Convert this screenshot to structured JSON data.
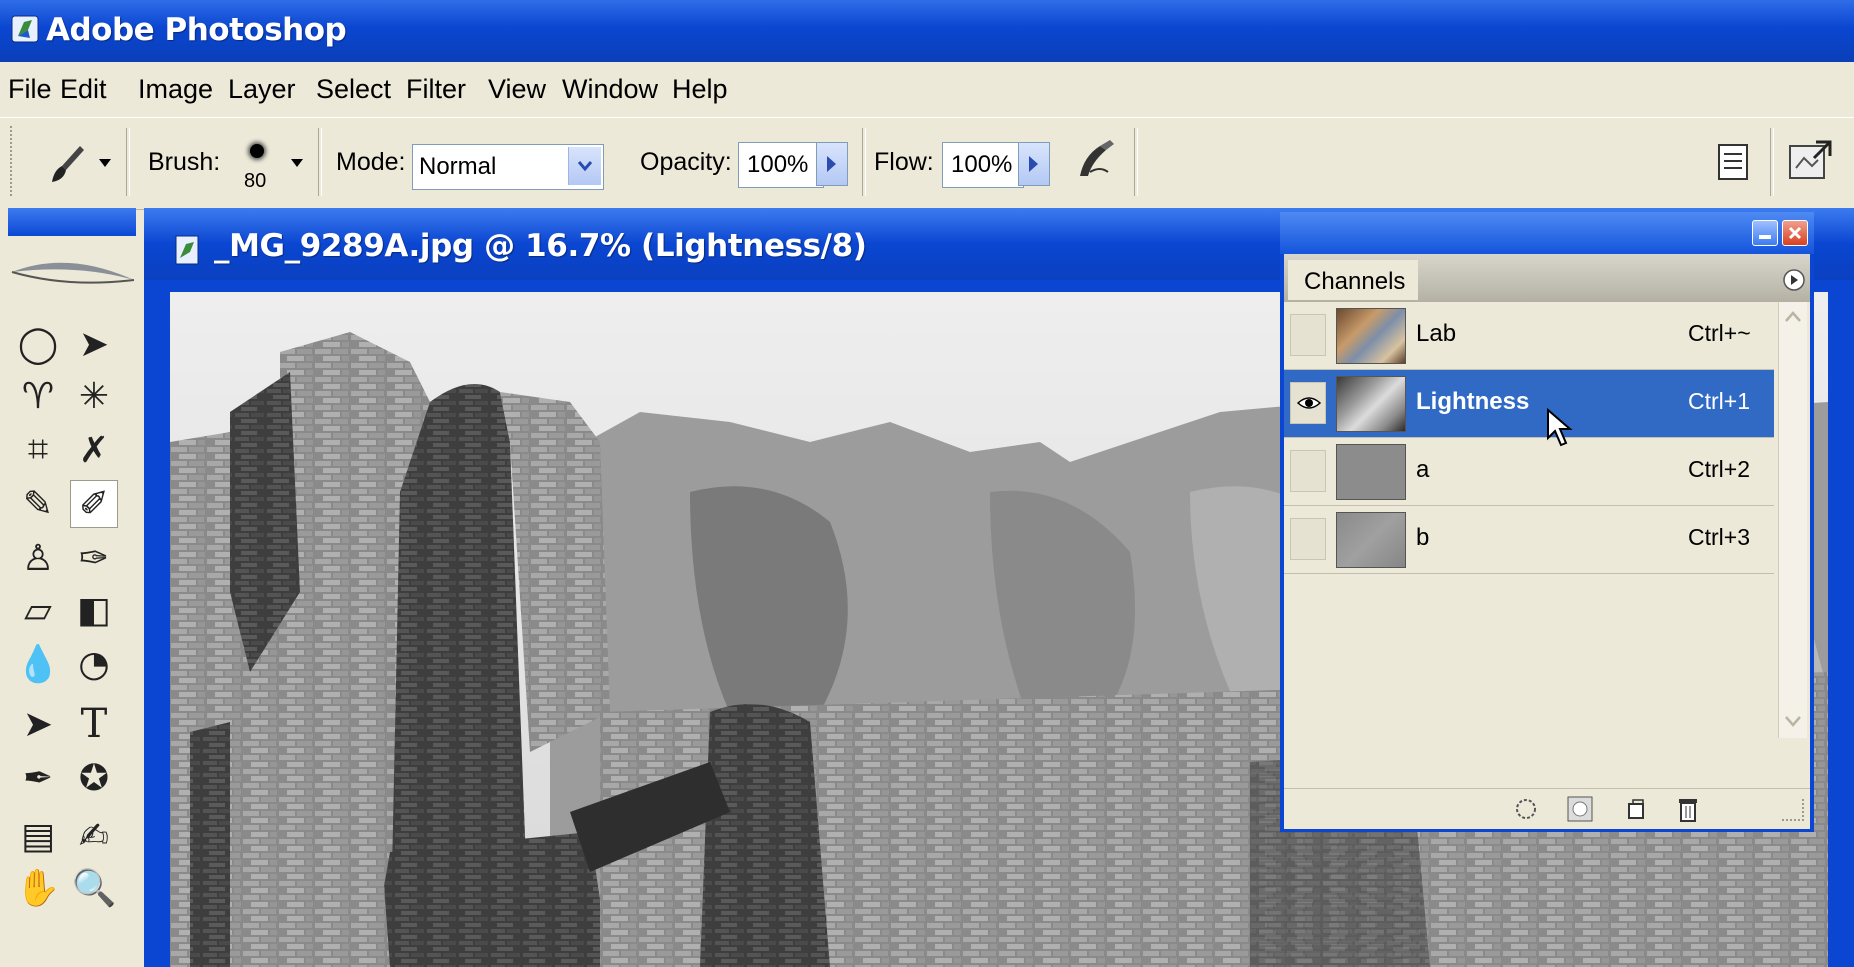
{
  "app": {
    "title": "Adobe Photoshop",
    "icon": "photoshop-icon"
  },
  "menu": [
    "File",
    "Edit",
    "Image",
    "Layer",
    "Select",
    "Filter",
    "View",
    "Window",
    "Help"
  ],
  "options": {
    "tool_icon": "brush-icon",
    "brush_label": "Brush:",
    "brush_size": "80",
    "mode_label": "Mode:",
    "mode_value": "Normal",
    "opacity_label": "Opacity:",
    "opacity_value": "100%",
    "flow_label": "Flow:",
    "flow_value": "100%",
    "airbrush_icon": "airbrush-icon",
    "palette_icon": "palette-well-icon",
    "bridge_icon": "file-browser-icon"
  },
  "document": {
    "title": "_MG_9289A.jpg @ 16.7% (Lightness/8)"
  },
  "channels_panel": {
    "tab": "Channels",
    "channels": [
      {
        "name": "Lab",
        "shortcut": "Ctrl+~",
        "visible": false,
        "selected": false
      },
      {
        "name": "Lightness",
        "shortcut": "Ctrl+1",
        "visible": true,
        "selected": true
      },
      {
        "name": "a",
        "shortcut": "Ctrl+2",
        "visible": false,
        "selected": false
      },
      {
        "name": "b",
        "shortcut": "Ctrl+3",
        "visible": false,
        "selected": false
      }
    ]
  },
  "colors": {
    "xp_blue": "#0a46d1",
    "panel_bg": "#ece9d8",
    "selection": "#316ac5"
  }
}
